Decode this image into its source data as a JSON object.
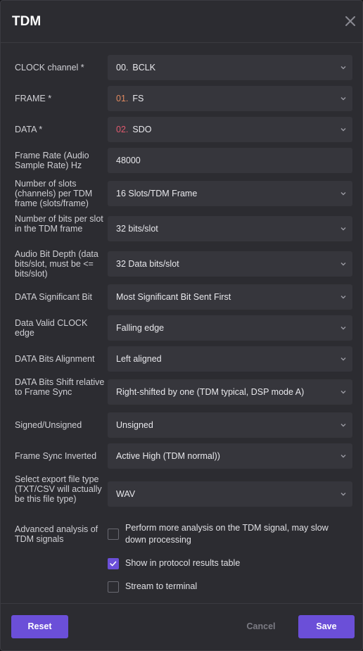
{
  "dialog": {
    "title": "TDM"
  },
  "fields": [
    {
      "label": "CLOCK channel *",
      "num": "00.",
      "num_color": "#e8e8ec",
      "value": "BCLK"
    },
    {
      "label": "FRAME *",
      "num": "01.",
      "num_color": "#e0895f",
      "value": "FS"
    },
    {
      "label": "DATA *",
      "num": "02.",
      "num_color": "#e05a6e",
      "value": "SDO"
    },
    {
      "label": "Frame Rate (Audio Sample Rate) Hz",
      "value": "48000"
    },
    {
      "label": "Number of slots (channels) per TDM frame (slots/frame)",
      "value": "16 Slots/TDM Frame"
    },
    {
      "label": "Number of bits per slot in the TDM frame",
      "value": "32 bits/slot"
    },
    {
      "label": "Audio Bit Depth (data bits/slot, must be <= bits/slot)",
      "value": "32 Data bits/slot"
    },
    {
      "label": "DATA Significant Bit",
      "value": "Most Significant Bit Sent First"
    },
    {
      "label": "Data Valid CLOCK edge",
      "value": "Falling edge"
    },
    {
      "label": "DATA Bits Alignment",
      "value": "Left aligned"
    },
    {
      "label": "DATA Bits Shift relative to Frame Sync",
      "value": "Right-shifted by one (TDM typical, DSP mode A)"
    },
    {
      "label": "Signed/Unsigned",
      "value": "Unsigned"
    },
    {
      "label": "Frame Sync Inverted",
      "value": "Active High (TDM normal))"
    },
    {
      "label": "Select export file type (TXT/CSV will actually be this file type)",
      "value": "WAV"
    }
  ],
  "advanced": {
    "label": "Advanced analysis of TDM signals",
    "options": [
      {
        "text": "Perform more analysis on the TDM signal, may slow down processing",
        "checked": false
      },
      {
        "text": "Show in protocol results table",
        "checked": true
      },
      {
        "text": "Stream to terminal",
        "checked": false
      }
    ]
  },
  "footer": {
    "reset_label": "Reset",
    "cancel_label": "Cancel",
    "save_label": "Save"
  },
  "colors": {
    "accent": "#6b4fd8",
    "background": "#2c2c31",
    "field": "#36363c"
  }
}
